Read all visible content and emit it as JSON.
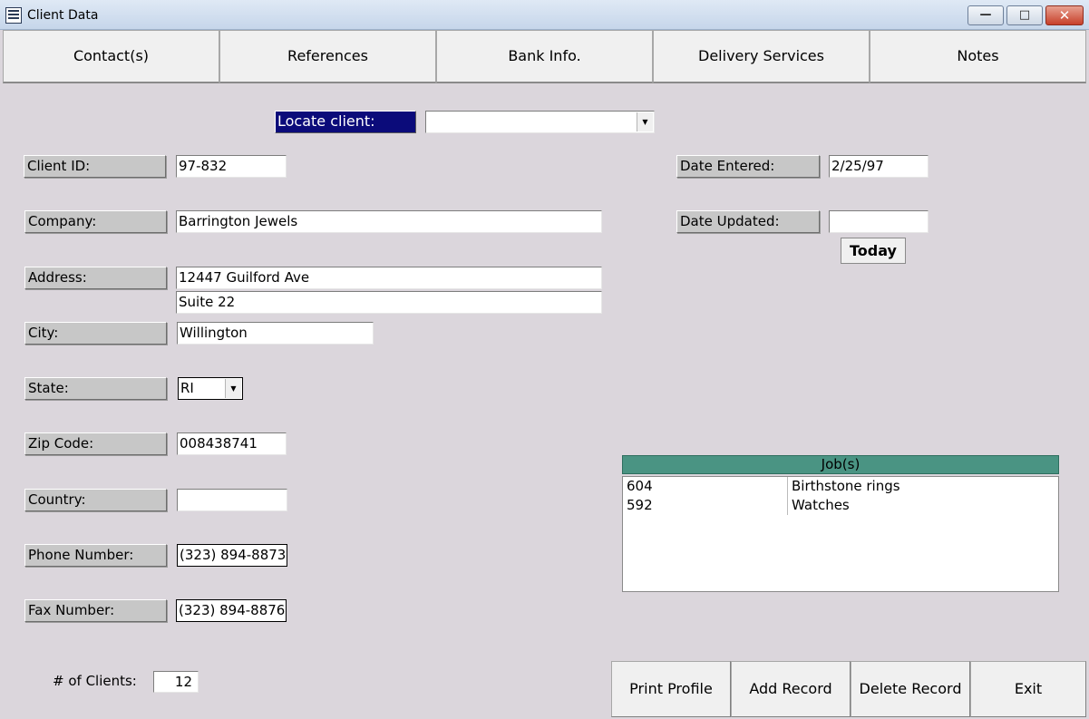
{
  "window": {
    "title": "Client Data",
    "min_label": "—",
    "max_label": "□",
    "close_label": "✕"
  },
  "tabs": [
    {
      "label": "Contact(s)"
    },
    {
      "label": "References"
    },
    {
      "label": "Bank Info."
    },
    {
      "label": "Delivery Services"
    },
    {
      "label": "Notes"
    }
  ],
  "locate": {
    "label": "Locate client:",
    "value": ""
  },
  "fields": {
    "client_id": {
      "label": "Client ID:",
      "value": "97-832"
    },
    "company": {
      "label": "Company:",
      "value": "Barrington Jewels"
    },
    "address": {
      "label": "Address:",
      "line1": "12447 Guilford Ave",
      "line2": "Suite 22"
    },
    "city": {
      "label": "City:",
      "value": "Willington"
    },
    "state": {
      "label": "State:",
      "value": "RI"
    },
    "zip": {
      "label": "Zip Code:",
      "value": "008438741"
    },
    "country": {
      "label": "Country:",
      "value": ""
    },
    "phone": {
      "label": "Phone Number:",
      "value": "(323) 894-8873"
    },
    "fax": {
      "label": "Fax Number:",
      "value": "(323) 894-8876"
    },
    "date_entered": {
      "label": "Date Entered:",
      "value": "2/25/97"
    },
    "date_updated": {
      "label": "Date Updated:",
      "value": ""
    }
  },
  "today_button": "Today",
  "jobs": {
    "header": "Job(s)",
    "rows": [
      {
        "id": "604",
        "desc": "Birthstone rings"
      },
      {
        "id": "592",
        "desc": "Watches"
      }
    ]
  },
  "clients": {
    "label": "# of Clients:",
    "value": "12"
  },
  "buttons": {
    "print": "Print Profile",
    "add": "Add Record",
    "delete": "Delete Record",
    "exit": "Exit"
  },
  "icons": {
    "app": "form-icon",
    "dropdown": "chevron-down-icon"
  }
}
